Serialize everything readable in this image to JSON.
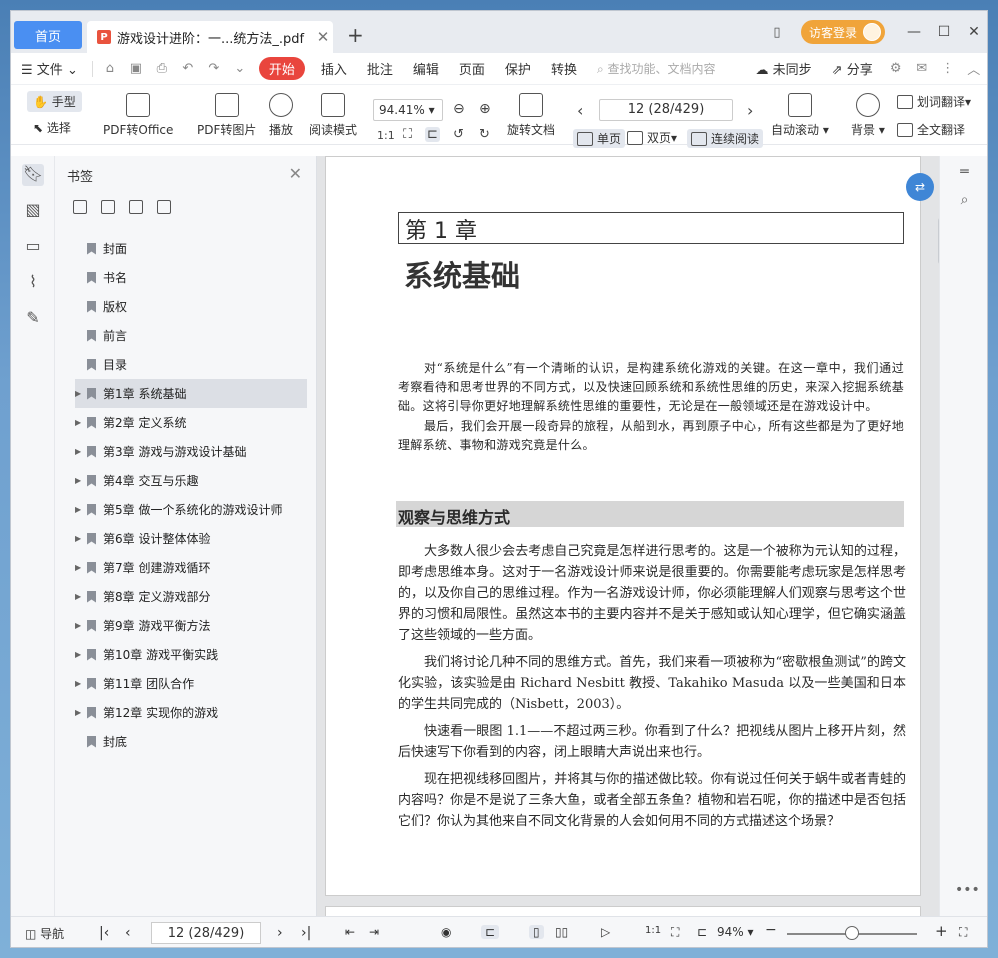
{
  "tabs": {
    "home": "首页",
    "doc": "游戏设计进阶：一...统方法_.pdf",
    "new_tab": "+"
  },
  "login": "访客登录",
  "menu": {
    "file": "文件",
    "start": "开始",
    "insert": "插入",
    "comment": "批注",
    "edit": "编辑",
    "page": "页面",
    "protect": "保护",
    "convert": "转换",
    "search_placeholder": "查找功能、文档内容",
    "sync": "未同步",
    "share": "分享"
  },
  "toolbar": {
    "hand": "手型",
    "select": "选择",
    "pdf_to_office": "PDF转Office",
    "pdf_to_image": "PDF转图片",
    "play": "播放",
    "read_mode": "阅读模式",
    "zoom": "94.41%",
    "page_input": "12 (28/429)",
    "rotate": "旋转文档",
    "single": "单页",
    "double": "双页",
    "continuous": "连续阅读",
    "autoscroll": "自动滚动",
    "background": "背景",
    "translate_word": "划词翻译",
    "translate_full": "全文翻译"
  },
  "sidebar": {
    "title": "书签",
    "items": [
      {
        "label": "封面",
        "expand": false
      },
      {
        "label": "书名",
        "expand": false
      },
      {
        "label": "版权",
        "expand": false
      },
      {
        "label": "前言",
        "expand": false
      },
      {
        "label": "目录",
        "expand": false
      },
      {
        "label": "第1章  系统基础",
        "expand": true,
        "selected": true
      },
      {
        "label": "第2章  定义系统",
        "expand": true
      },
      {
        "label": "第3章  游戏与游戏设计基础",
        "expand": true
      },
      {
        "label": "第4章  交互与乐趣",
        "expand": true
      },
      {
        "label": "第5章  做一个系统化的游戏设计师",
        "expand": true
      },
      {
        "label": "第6章  设计整体体验",
        "expand": true
      },
      {
        "label": "第7章  创建游戏循环",
        "expand": true
      },
      {
        "label": "第8章  定义游戏部分",
        "expand": true
      },
      {
        "label": "第9章  游戏平衡方法",
        "expand": true
      },
      {
        "label": "第10章  游戏平衡实践",
        "expand": true
      },
      {
        "label": "第11章  团队合作",
        "expand": true
      },
      {
        "label": "第12章  实现你的游戏",
        "expand": true
      },
      {
        "label": "封底",
        "expand": false
      }
    ]
  },
  "document": {
    "chapter": "第 1 章",
    "title": "系统基础",
    "intro": [
      "对“系统是什么”有一个清晰的认识，是构建系统化游戏的关键。在这一章中，我们通过考察看待和思考世界的不同方式，以及快速回顾系统和系统性思维的历史，来深入挖掘系统基础。这将引导你更好地理解系统性思维的重要性，无论是在一般领域还是在游戏设计中。",
      "最后，我们会开展一段奇异的旅程，从船到水，再到原子中心，所有这些都是为了更好地理解系统、事物和游戏究竟是什么。"
    ],
    "section": "观察与思维方式",
    "paragraphs": [
      "大多数人很少会去考虑自己究竟是怎样进行思考的。这是一个被称为元认知的过程，即考虑思维本身。这对于一名游戏设计师来说是很重要的。你需要能考虑玩家是怎样思考的，以及你自己的思维过程。作为一名游戏设计师，你必须能理解人们观察与思考这个世界的习惯和局限性。虽然这本书的主要内容并不是关于感知或认知心理学，但它确实涵盖了这些领域的一些方面。",
      "我们将讨论几种不同的思维方式。首先，我们来看一项被称为“密歇根鱼测试”的跨文化实验，该实验是由 Richard Nesbitt 教授、Takahiko Masuda 以及一些美国和日本的学生共同完成的（Nisbett，2003）。",
      "快速看一眼图 1.1——不超过两三秒。你看到了什么？把视线从图片上移开片刻，然后快速写下你看到的内容，闭上眼睛大声说出来也行。",
      "现在把视线移回图片，并将其与你的描述做比较。你有说过任何关于蜗牛或者青蛙的内容吗？你是不是说了三条大鱼，或者全部五条鱼？植物和岩石呢，你的描述中是否包括它们？你认为其他来自不同文化背景的人会如何用不同的方式描述这个场景？"
    ]
  },
  "status": {
    "nav": "导航",
    "page": "12 (28/429)",
    "zoom": "94%"
  }
}
